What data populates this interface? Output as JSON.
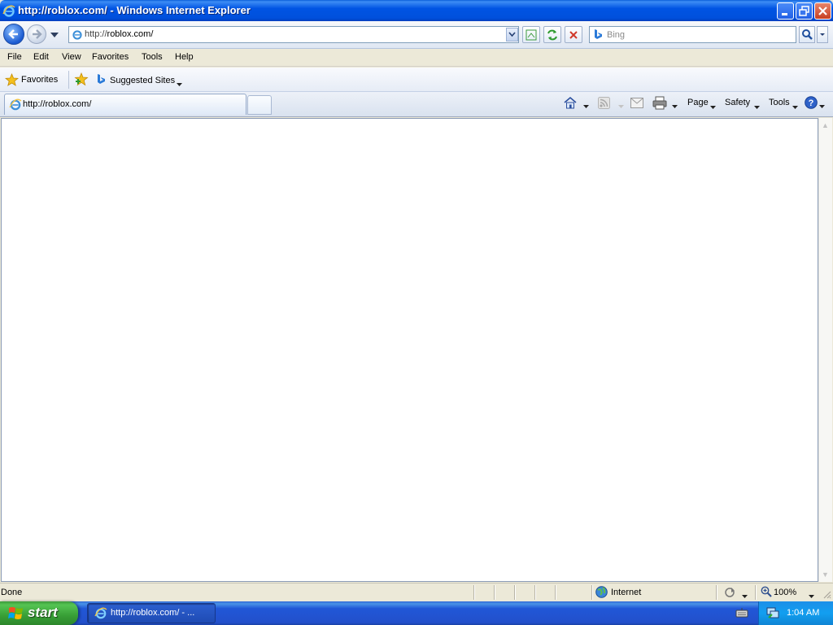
{
  "window": {
    "title": "http://roblox.com/ - Windows Internet Explorer"
  },
  "nav": {
    "address_prefix": "http://",
    "address_host": "roblox.com/",
    "search_placeholder": "Bing"
  },
  "menu": [
    "File",
    "Edit",
    "View",
    "Favorites",
    "Tools",
    "Help"
  ],
  "favorites_bar": {
    "favorites_label": "Favorites",
    "suggested_sites_label": "Suggested Sites"
  },
  "tab": {
    "title": "http://roblox.com/"
  },
  "command_bar": {
    "page": "Page",
    "safety": "Safety",
    "tools": "Tools"
  },
  "status_bar": {
    "status": "Done",
    "zone": "Internet",
    "zoom": "100%"
  },
  "taskbar": {
    "start": "start",
    "task_label": "http://roblox.com/ - ...",
    "clock": "1:04 AM"
  },
  "colors": {
    "title_blue": "#0054e3",
    "start_green": "#389f36",
    "taskbar_blue": "#2250cb"
  }
}
